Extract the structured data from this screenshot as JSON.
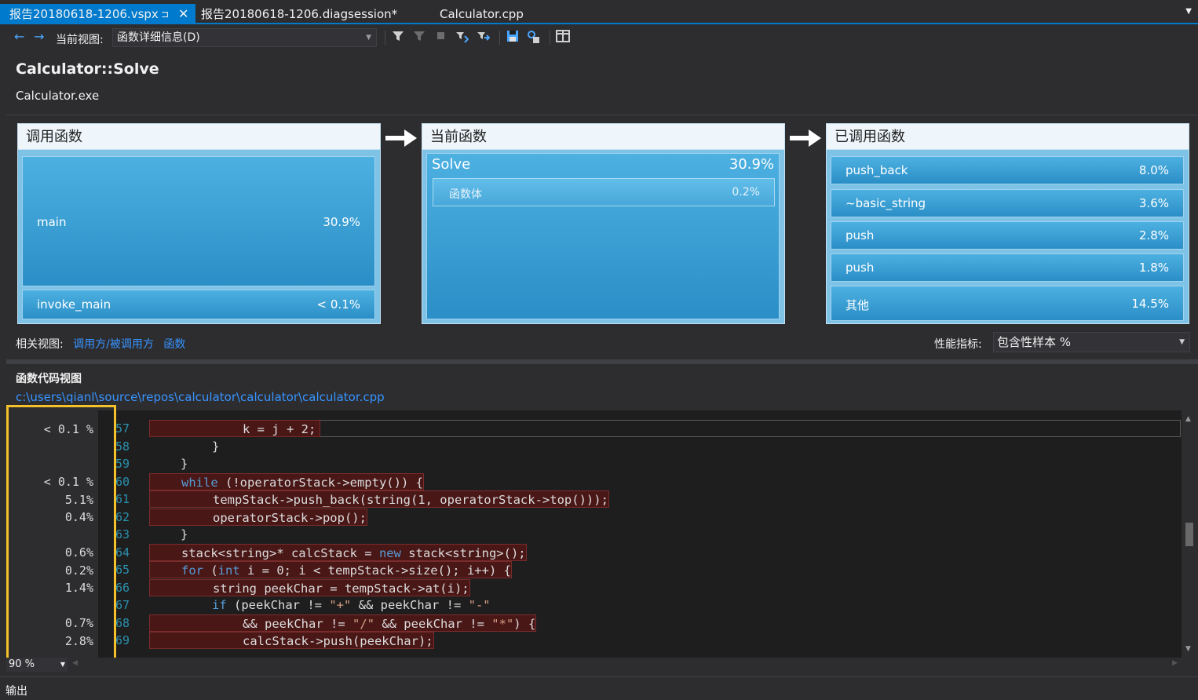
{
  "tabs": {
    "active": "报告20180618-1206.vspx",
    "second": "报告20180618-1206.diagsession*",
    "third": "Calculator.cpp",
    "pin_glyph": "⊐",
    "close_glyph": "✕"
  },
  "toolbar": {
    "current_view_label": "当前视图:",
    "current_view_value": "函数详细信息(D)"
  },
  "header": {
    "function_name": "Calculator::Solve",
    "module": "Calculator.exe"
  },
  "callers_panel": {
    "title": "调用函数",
    "items": [
      {
        "label": "main",
        "pct": "30.9%"
      },
      {
        "label": "invoke_main",
        "pct": "< 0.1%"
      }
    ]
  },
  "current_panel": {
    "title": "当前函数",
    "name": "Solve",
    "pct": "30.9%",
    "body_label": "函数体",
    "body_pct": "0.2%"
  },
  "callees_panel": {
    "title": "已调用函数",
    "items": [
      {
        "label": "push_back",
        "pct": "8.0%"
      },
      {
        "label": "~basic_string",
        "pct": "3.6%"
      },
      {
        "label": "push",
        "pct": "2.8%"
      },
      {
        "label": "push",
        "pct": "1.8%"
      },
      {
        "label": "其他",
        "pct": "14.5%"
      }
    ]
  },
  "related": {
    "label": "相关视图:",
    "link1": "调用方/被调用方",
    "link2": "函数"
  },
  "metric": {
    "label": "性能指标:",
    "value": "包含性样本 %"
  },
  "code_view": {
    "title": "函数代码视图",
    "path": "c:\\users\\qianl\\source\\repos\\calculator\\calculator\\calculator.cpp",
    "lines": [
      {
        "pct": "< 0.1 %",
        "ln": "57"
      },
      {
        "pct": "",
        "ln": "58"
      },
      {
        "pct": "",
        "ln": "59"
      },
      {
        "pct": "< 0.1 %",
        "ln": "60"
      },
      {
        "pct": "5.1%",
        "ln": "61"
      },
      {
        "pct": "0.4%",
        "ln": "62"
      },
      {
        "pct": "",
        "ln": "63"
      },
      {
        "pct": "0.6%",
        "ln": "64"
      },
      {
        "pct": "0.2%",
        "ln": "65"
      },
      {
        "pct": "1.4%",
        "ln": "66"
      },
      {
        "pct": "",
        "ln": "67"
      },
      {
        "pct": "0.7%",
        "ln": "68"
      },
      {
        "pct": "2.8%",
        "ln": "69"
      }
    ],
    "code": {
      "l57": "k = j + 2;",
      "l58": "}",
      "l59": "}",
      "l60_kw": "while",
      "l60_rest": " (!operatorStack->empty()) {",
      "l61": "tempStack->push_back(string(1, operatorStack->top()));",
      "l62": "operatorStack->pop();",
      "l63": "}",
      "l64_a": "stack<string>* calcStack = ",
      "l64_kw": "new",
      "l64_b": " stack<string>();",
      "l65_kw": "for",
      "l65_a": " (",
      "l65_kw2": "int",
      "l65_b": " i = 0; i < tempStack->size(); i++) {",
      "l66": "string peekChar = tempStack->at(i);",
      "l67_kw": "if",
      "l67_a": " (peekChar != ",
      "l67_s1": "\"+\"",
      "l67_b": " && peekChar != ",
      "l67_s2": "\"-\"",
      "l68_a": "&& peekChar != ",
      "l68_s1": "\"/\"",
      "l68_b": " && peekChar != ",
      "l68_s2": "\"*\"",
      "l68_c": ") {",
      "l69": "calcStack->push(peekChar);"
    }
  },
  "zoom": "90 %",
  "output_label": "输出"
}
